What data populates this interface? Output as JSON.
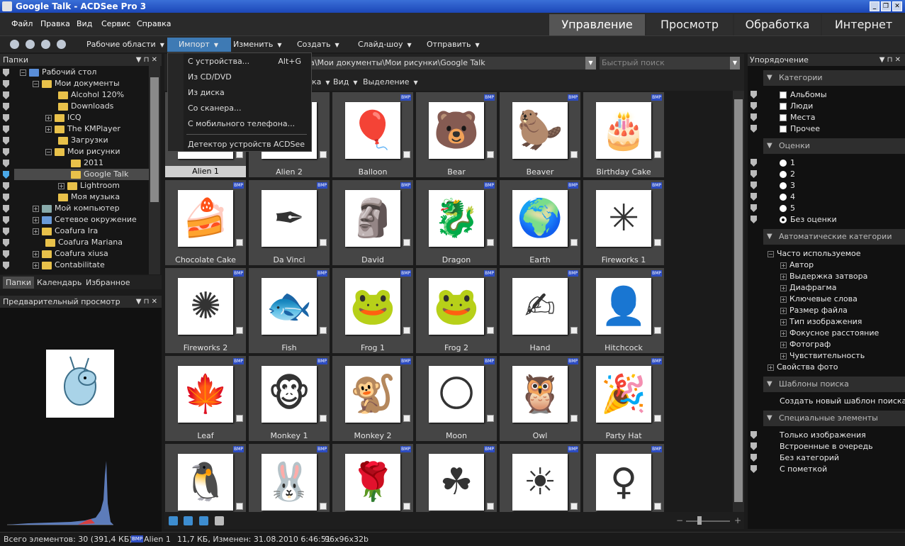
{
  "window": {
    "title": "Google Talk - ACDSee Pro 3"
  },
  "menu": [
    "Файл",
    "Правка",
    "Вид",
    "Сервис",
    "Справка"
  ],
  "mode_tabs": [
    "Управление",
    "Просмотр",
    "Обработка",
    "Интернет"
  ],
  "toolbar": {
    "workspaces": "Рабочие области",
    "import": "Импорт",
    "edit": "Изменить",
    "create": "Создать",
    "slideshow": "Слайд-шоу",
    "send": "Отправить"
  },
  "import_menu": {
    "items": [
      "С устройства...",
      "Из CD/DVD",
      "Из диска",
      "Со сканера...",
      "С мобильного телефона..."
    ],
    "shortcut": "Alt+G",
    "detector": "Детектор устройств ACDSee"
  },
  "folders": {
    "title": "Папки",
    "items": [
      "Рабочий стол",
      "Мои документы",
      "Alcohol 120%",
      "Downloads",
      "ICQ",
      "The KMPlayer",
      "Загрузки",
      "Мои рисунки",
      "2011",
      "Google Talk",
      "Lightroom",
      "Моя музыка",
      "Мой компьютер",
      "Сетевое окружение",
      "Coafura Ira",
      "Coafura Mariana",
      "Coafura xiusa",
      "Contabilitate"
    ]
  },
  "left_tabs": [
    "Папки",
    "Календарь",
    "Избранное"
  ],
  "preview": {
    "title": "Предварительный просмотр"
  },
  "path": {
    "value": "чка\\Мои документы\\Мои рисунки\\Google Talk",
    "search_placeholder": "Быстрый поиск"
  },
  "center_toolbar": {
    "sort": "ка",
    "view": "Вид",
    "select": "Выделение"
  },
  "thumbnails": [
    {
      "label": "Alien 1",
      "emoji": ""
    },
    {
      "label": "Alien 2",
      "emoji": ""
    },
    {
      "label": "Balloon",
      "emoji": "🎈"
    },
    {
      "label": "Bear",
      "emoji": "🐻"
    },
    {
      "label": "Beaver",
      "emoji": "🦫"
    },
    {
      "label": "Birthday Cake",
      "emoji": "🎂"
    },
    {
      "label": "Chocolate Cake",
      "emoji": "🍰"
    },
    {
      "label": "Da Vinci",
      "emoji": "✒"
    },
    {
      "label": "David",
      "emoji": "🗿"
    },
    {
      "label": "Dragon",
      "emoji": "🐉"
    },
    {
      "label": "Earth",
      "emoji": "🌍"
    },
    {
      "label": "Fireworks 1",
      "emoji": "✳"
    },
    {
      "label": "Fireworks 2",
      "emoji": "✺"
    },
    {
      "label": "Fish",
      "emoji": "🐟"
    },
    {
      "label": "Frog 1",
      "emoji": "🐸"
    },
    {
      "label": "Frog 2",
      "emoji": "🐸"
    },
    {
      "label": "Hand",
      "emoji": "✍"
    },
    {
      "label": "Hitchcock",
      "emoji": "👤"
    },
    {
      "label": "Leaf",
      "emoji": "🍁"
    },
    {
      "label": "Monkey 1",
      "emoji": "🐵"
    },
    {
      "label": "Monkey 2",
      "emoji": "🐒"
    },
    {
      "label": "Moon",
      "emoji": "🌕"
    },
    {
      "label": "Owl",
      "emoji": "🦉"
    },
    {
      "label": "Party Hat",
      "emoji": "🎉"
    },
    {
      "label": "",
      "emoji": "🐧"
    },
    {
      "label": "",
      "emoji": "🐰"
    },
    {
      "label": "",
      "emoji": "🌹"
    },
    {
      "label": "",
      "emoji": "☘"
    },
    {
      "label": "",
      "emoji": "☀"
    },
    {
      "label": "",
      "emoji": "♀"
    }
  ],
  "badge": "BMP",
  "right_panel": {
    "title": "Упорядочение",
    "categories": {
      "title": "Категории",
      "items": [
        "Альбомы",
        "Люди",
        "Места",
        "Прочее"
      ]
    },
    "ratings": {
      "title": "Оценки",
      "items": [
        "1",
        "2",
        "3",
        "4",
        "5",
        "Без оценки"
      ],
      "selected": "Без оценки"
    },
    "auto": {
      "title": "Автоматические категории",
      "group": "Часто используемое",
      "items": [
        "Автор",
        "Выдержка затвора",
        "Диафрагма",
        "Ключевые слова",
        "Размер файла",
        "Тип изображения",
        "Фокусное расстояние",
        "Фотограф",
        "Чувствительность"
      ],
      "photo_props": "Свойства фото"
    },
    "search": {
      "title": "Шаблоны поиска",
      "create": "Создать новый шаблон поиска"
    },
    "special": {
      "title": "Специальные элементы",
      "items": [
        "Только изображения",
        "Встроенные в очередь",
        "Без категорий",
        "С пометкой"
      ]
    }
  },
  "status": {
    "total": "Всего элементов: 30  (391,4 КБ)",
    "file": "Alien 1",
    "info": "11,7 КБ, Изменен: 31.08.2010 6:46:51",
    "dims": "96x96x32b"
  },
  "colors": {
    "accent": "#3e7ab4",
    "title": "#1c47b8"
  }
}
